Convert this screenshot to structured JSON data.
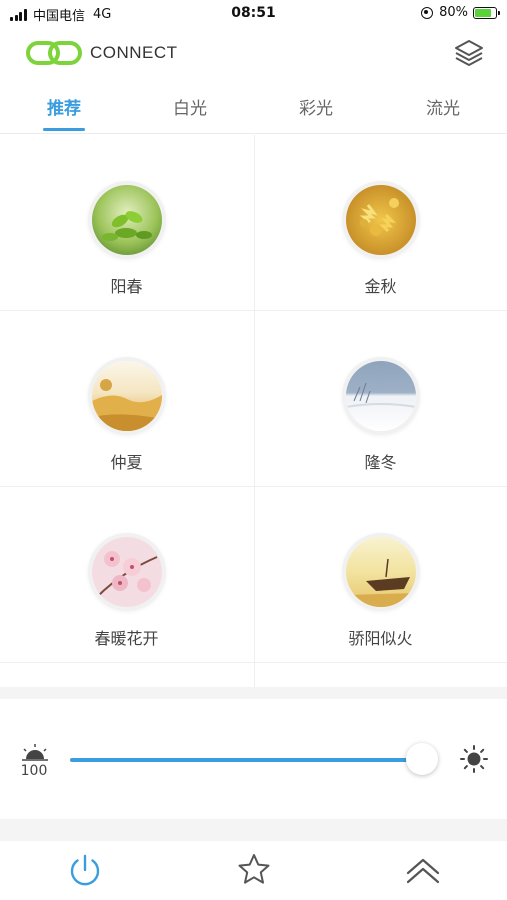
{
  "status_bar": {
    "carrier": "中国电信",
    "network": "4G",
    "time": "08:51",
    "battery_percent": "80%",
    "battery_level": 0.8
  },
  "header": {
    "app_name": "CONNECT",
    "logo_color": "#7dd33a",
    "menu_icon": "layers-icon"
  },
  "tabs": [
    {
      "label": "推荐",
      "active": true
    },
    {
      "label": "白光",
      "active": false
    },
    {
      "label": "彩光",
      "active": false
    },
    {
      "label": "流光",
      "active": false
    }
  ],
  "accent_color": "#3a9de0",
  "scenes": [
    {
      "label": "阳春",
      "icon": "green-leaves-photo"
    },
    {
      "label": "金秋",
      "icon": "autumn-leaves-photo"
    },
    {
      "label": "仲夏",
      "icon": "summer-sunset-photo"
    },
    {
      "label": "隆冬",
      "icon": "winter-lake-photo"
    },
    {
      "label": "春暖花开",
      "icon": "cherry-blossom-photo"
    },
    {
      "label": "骄阳似火",
      "icon": "boat-sunset-photo"
    }
  ],
  "brightness": {
    "value": "100",
    "level": 1.0,
    "min_icon": "sunrise-dim-icon",
    "max_icon": "sun-bright-icon"
  },
  "bottom_bar": {
    "items": [
      "power-icon",
      "star-icon",
      "chevron-up-icon"
    ]
  }
}
